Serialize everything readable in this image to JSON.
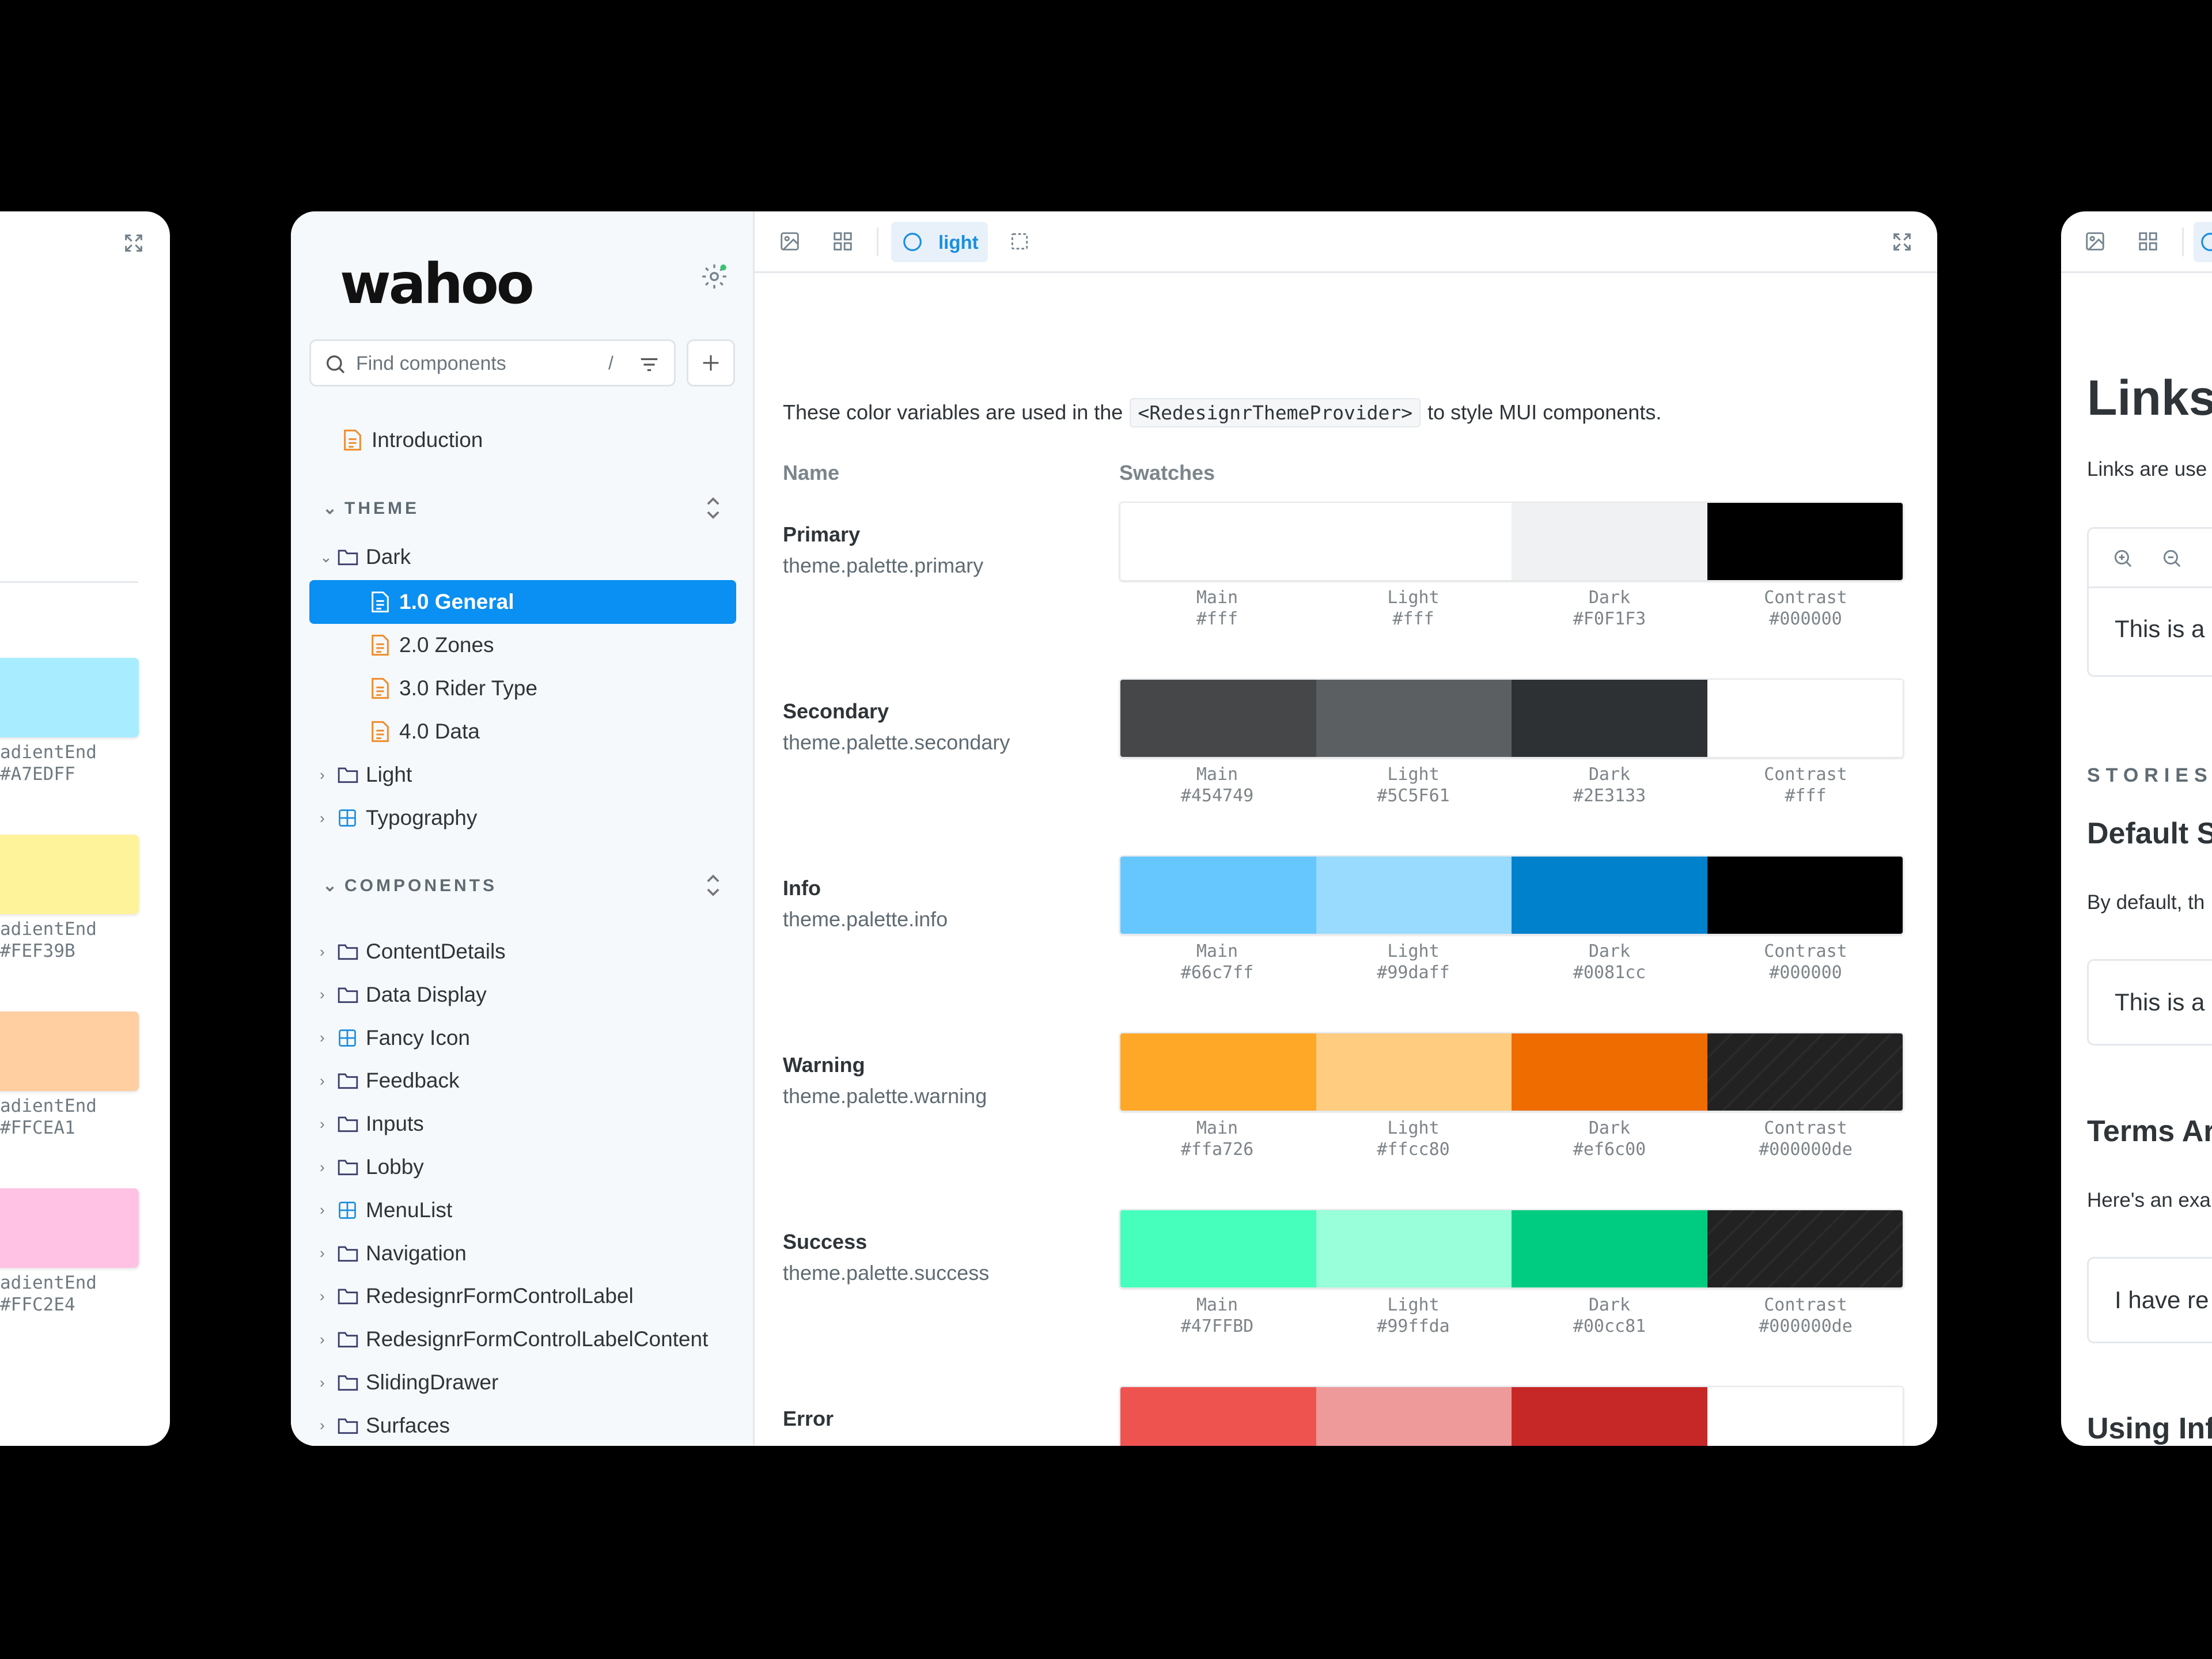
{
  "left_card": {
    "swatches": [
      {
        "label": "adientEnd",
        "hex": "#A7EDFF",
        "color": "#A7EDFF"
      },
      {
        "label": "adientEnd",
        "hex": "#FEF39B",
        "color": "#FEF39B"
      },
      {
        "label": "adientEnd",
        "hex": "#FFCEA1",
        "color": "#FFCEA1"
      },
      {
        "label": "adientEnd",
        "hex": "#FFC2E4",
        "color": "#FFC2E4"
      }
    ]
  },
  "sidebar": {
    "logo": "wahoo",
    "search_placeholder": "Find components",
    "search_shortcut": "/",
    "intro_item": "Introduction",
    "theme_section": "THEME",
    "theme_items": [
      {
        "label": "Dark"
      },
      {
        "label": "1.0 General"
      },
      {
        "label": "2.0 Zones"
      },
      {
        "label": "3.0 Rider Type"
      },
      {
        "label": "4.0 Data"
      },
      {
        "label": "Light"
      },
      {
        "label": "Typography"
      }
    ],
    "components_section": "COMPONENTS",
    "component_items": [
      {
        "label": "ContentDetails"
      },
      {
        "label": "Data Display"
      },
      {
        "label": "Fancy Icon"
      },
      {
        "label": "Feedback"
      },
      {
        "label": "Inputs"
      },
      {
        "label": "Lobby"
      },
      {
        "label": "MenuList"
      },
      {
        "label": "Navigation"
      },
      {
        "label": "RedesignrFormControlLabel"
      },
      {
        "label": "RedesignrFormControlLabelContent"
      },
      {
        "label": "SlidingDrawer"
      },
      {
        "label": "Surfaces"
      }
    ]
  },
  "toolbar": {
    "theme_toggle": "light"
  },
  "content": {
    "intro_before": "These color variables are used in the",
    "intro_code": "<RedesignrThemeProvider>",
    "intro_after": "to style MUI components.",
    "col_name": "Name",
    "col_swatches": "Swatches",
    "rows": [
      {
        "name": "Primary",
        "path": "theme.palette.primary",
        "swatches": [
          {
            "label": "Main",
            "hex": "#fff",
            "color": "#ffffff"
          },
          {
            "label": "Light",
            "hex": "#fff",
            "color": "#ffffff"
          },
          {
            "label": "Dark",
            "hex": "#F0F1F3",
            "color": "#F0F1F3"
          },
          {
            "label": "Contrast",
            "hex": "#000000",
            "color": "#000000"
          }
        ]
      },
      {
        "name": "Secondary",
        "path": "theme.palette.secondary",
        "swatches": [
          {
            "label": "Main",
            "hex": "#454749",
            "color": "#454749"
          },
          {
            "label": "Light",
            "hex": "#5C5F61",
            "color": "#5C5F61"
          },
          {
            "label": "Dark",
            "hex": "#2E3133",
            "color": "#2E3133"
          },
          {
            "label": "Contrast",
            "hex": "#fff",
            "color": "#ffffff"
          }
        ]
      },
      {
        "name": "Info",
        "path": "theme.palette.info",
        "swatches": [
          {
            "label": "Main",
            "hex": "#66c7ff",
            "color": "#66c7ff"
          },
          {
            "label": "Light",
            "hex": "#99daff",
            "color": "#99daff"
          },
          {
            "label": "Dark",
            "hex": "#0081cc",
            "color": "#0081cc"
          },
          {
            "label": "Contrast",
            "hex": "#000000",
            "color": "#000000"
          }
        ]
      },
      {
        "name": "Warning",
        "path": "theme.palette.warning",
        "swatches": [
          {
            "label": "Main",
            "hex": "#ffa726",
            "color": "#ffa726"
          },
          {
            "label": "Light",
            "hex": "#ffcc80",
            "color": "#ffcc80"
          },
          {
            "label": "Dark",
            "hex": "#ef6c00",
            "color": "#ef6c00"
          },
          {
            "label": "Contrast",
            "hex": "#000000de",
            "color": "#222222"
          }
        ]
      },
      {
        "name": "Success",
        "path": "theme.palette.success",
        "swatches": [
          {
            "label": "Main",
            "hex": "#47FFBD",
            "color": "#47FFBD"
          },
          {
            "label": "Light",
            "hex": "#99ffda",
            "color": "#99ffda"
          },
          {
            "label": "Dark",
            "hex": "#00cc81",
            "color": "#00cc81"
          },
          {
            "label": "Contrast",
            "hex": "#000000de",
            "color": "#222222"
          }
        ]
      },
      {
        "name": "Error",
        "path": "",
        "swatches": [
          {
            "label": "",
            "hex": "",
            "color": "#ef5350"
          },
          {
            "label": "",
            "hex": "",
            "color": "#ef9a9a"
          },
          {
            "label": "",
            "hex": "",
            "color": "#c62828"
          },
          {
            "label": "",
            "hex": "",
            "color": "#ffffff"
          }
        ]
      }
    ]
  },
  "right_card": {
    "title": "Links",
    "intro": "Links are use",
    "preview_text": "This is a",
    "stories_label": "STORIES",
    "heading1": "Default S",
    "text1": "By default, th",
    "preview2": "This is a",
    "heading2": "Terms Ar",
    "text2": "Here's an exa",
    "preview3": "I have re",
    "heading3": "Using Inf"
  },
  "colors": {
    "accent": "#0a8ff2",
    "background": "#000000",
    "sidebar_bg": "#f6f9fc"
  }
}
